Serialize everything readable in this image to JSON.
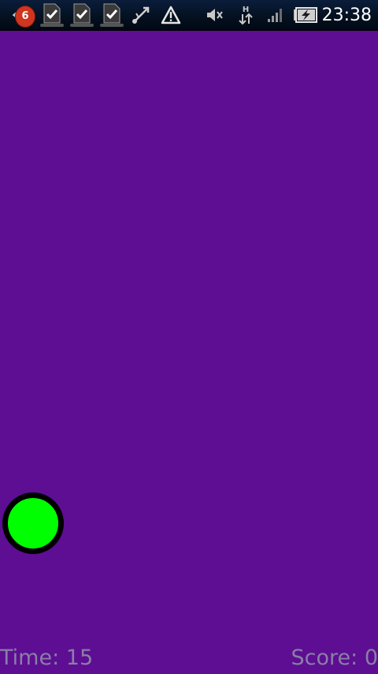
{
  "status_bar": {
    "notification_count": "6",
    "clock": "23:38",
    "icons": [
      "back-notification-icon",
      "task-complete-icon",
      "task-complete-icon",
      "task-complete-icon",
      "usb-debug-icon",
      "warning-icon",
      "mute-icon",
      "hspa-data-icon",
      "signal-icon",
      "battery-charging-icon"
    ]
  },
  "game": {
    "ball_color": "#00ff00",
    "background_color": "#5d0e93"
  },
  "hud": {
    "time_label": "Time: ",
    "time_value": "15",
    "score_label": "Score: ",
    "score_value": "0"
  }
}
